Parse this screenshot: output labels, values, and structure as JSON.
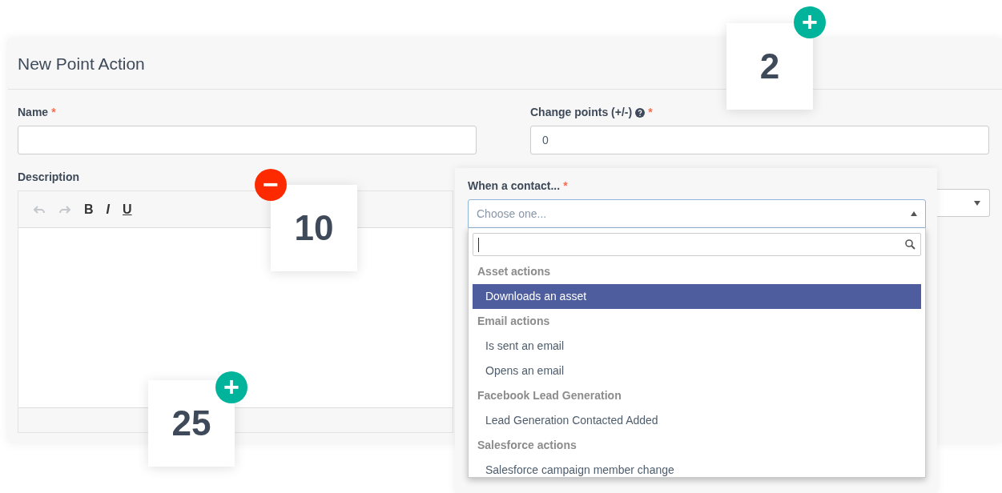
{
  "dialog": {
    "title": "New Point Action"
  },
  "fields": [
    {
      "label": "Name",
      "required_mark": "*"
    },
    {
      "label": "Change points (+/-)",
      "required_mark": "*",
      "help": true,
      "value": "0"
    }
  ],
  "description": {
    "label": "Description",
    "toolbar": [
      {
        "kind": "undo",
        "disabled": true
      },
      {
        "kind": "redo",
        "disabled": true
      },
      {
        "kind": "bold",
        "label": "B"
      },
      {
        "kind": "italic",
        "label": "I"
      },
      {
        "kind": "underline",
        "label": "U"
      }
    ]
  },
  "contact_select": {
    "label": "When a contact...",
    "required_mark": "*",
    "placeholder": "Choose one...",
    "expanded": true,
    "groups": [
      {
        "label": "Asset actions",
        "options": [
          {
            "label": "Downloads an asset",
            "selected": true
          }
        ]
      },
      {
        "label": "Email actions",
        "options": [
          {
            "label": "Is sent an email",
            "selected": false
          },
          {
            "label": "Opens an email",
            "selected": false
          }
        ]
      },
      {
        "label": "Facebook Lead Generation",
        "options": [
          {
            "label": "Lead Generation Contacted Added",
            "selected": false
          }
        ]
      },
      {
        "label": "Salesforce actions",
        "options": [
          {
            "label": "Salesforce campaign member change",
            "selected": false
          }
        ]
      }
    ]
  },
  "score_cards": [
    {
      "value": "2",
      "kind": "gain",
      "badge": "+"
    },
    {
      "value": "10",
      "kind": "loss",
      "badge": "−"
    },
    {
      "value": "25",
      "kind": "gain",
      "badge": "+"
    }
  ]
}
